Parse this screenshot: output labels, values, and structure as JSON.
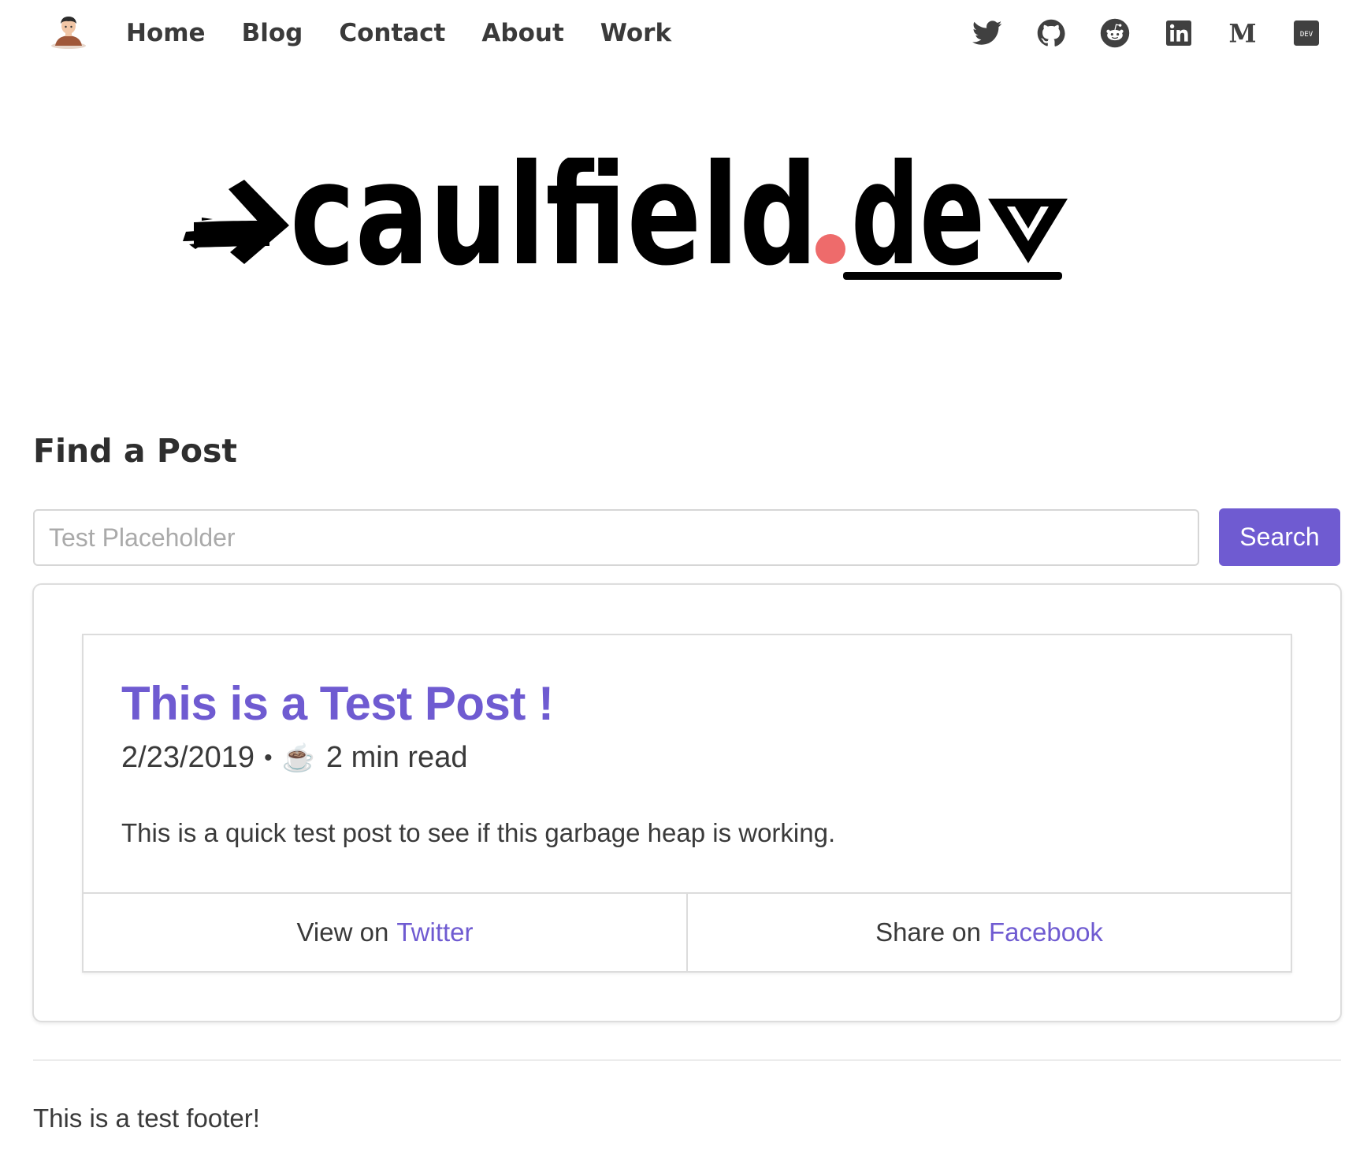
{
  "nav": {
    "avatar_icon": "avatar-icon",
    "links": [
      {
        "label": "Home"
      },
      {
        "label": "Blog"
      },
      {
        "label": "Contact"
      },
      {
        "label": "About"
      },
      {
        "label": "Work"
      }
    ],
    "social": [
      {
        "icon": "twitter-icon"
      },
      {
        "icon": "github-icon"
      },
      {
        "icon": "reddit-icon"
      },
      {
        "icon": "linkedin-icon"
      },
      {
        "icon": "medium-icon"
      },
      {
        "icon": "dev-icon"
      }
    ]
  },
  "logo": {
    "text_main": "caulfield",
    "text_tld": "dev",
    "accent_color": "#ee6b6b"
  },
  "search": {
    "heading": "Find a Post",
    "placeholder": "Test Placeholder",
    "value": "",
    "button_label": "Search"
  },
  "post": {
    "title": "This is a Test Post !",
    "date": "2/23/2019",
    "separator": "•",
    "coffee_icon": "☕",
    "read_time": "2 min read",
    "excerpt": "This is a quick test post to see if this garbage heap is working.",
    "twitter_prefix": "View on",
    "twitter_link": "Twitter",
    "facebook_prefix": "Share on",
    "facebook_link": "Facebook"
  },
  "footer": {
    "text": "This is a test footer!"
  },
  "colors": {
    "accent": "#6f5bd1",
    "text": "#3a3a3a",
    "logo_dot": "#ee6b6b"
  }
}
